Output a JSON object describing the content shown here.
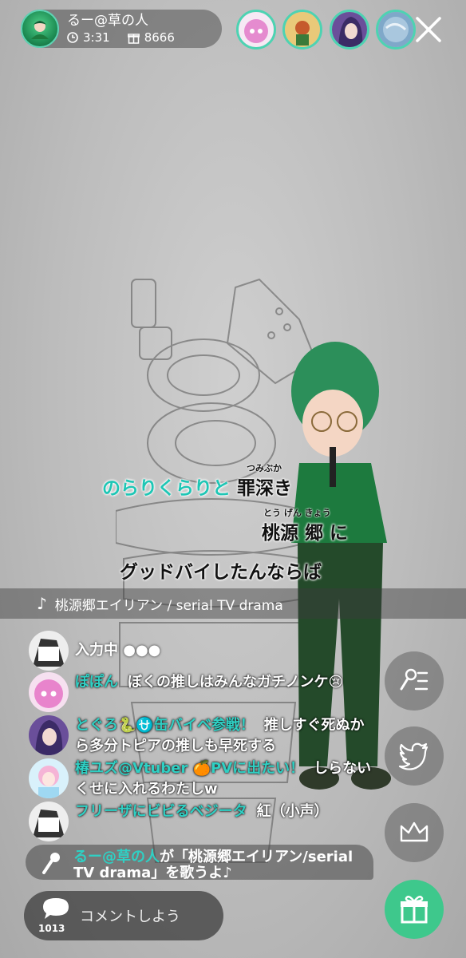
{
  "header": {
    "streamer_name": "るー@草の人",
    "duration": "3:31",
    "gift_points": "8666"
  },
  "lyrics": {
    "line1_cyan": "のらりくらりと",
    "line1_black": "罪深き",
    "line1_ruby": "つみぶか",
    "line2": "桃源 郷 に",
    "line2_ruby": "とう げん きょう",
    "line3": "グッドバイしたんならば"
  },
  "song": {
    "title": "桃源郷エイリアン / serial TV drama"
  },
  "comments": [
    {
      "typing": "入力中 ●●●"
    },
    {
      "name": "ぽぽん",
      "text": "ぼくの推しはみんなガチノンケ😢"
    },
    {
      "name": "とぐろ🐍⛎缶バイベ参戦！",
      "text": "推しすぐ死ぬから多分トピアの推しも早死する"
    },
    {
      "name": "椿ユズ@Vtuber 🍊PVに出たい！",
      "text": "しらないくせに入れるわたしw"
    },
    {
      "name": "フリーザにビビるベジータ",
      "text": "紅（小声）"
    }
  ],
  "system_message": {
    "name": "るー@草の人",
    "text": "が「桃源郷エイリアン/serial TV drama」を歌うよ♪"
  },
  "comment_input": {
    "placeholder": "コメントしよう",
    "count": "1013"
  },
  "colors": {
    "accent": "#2fd0c4",
    "gift": "#3ec88c"
  }
}
